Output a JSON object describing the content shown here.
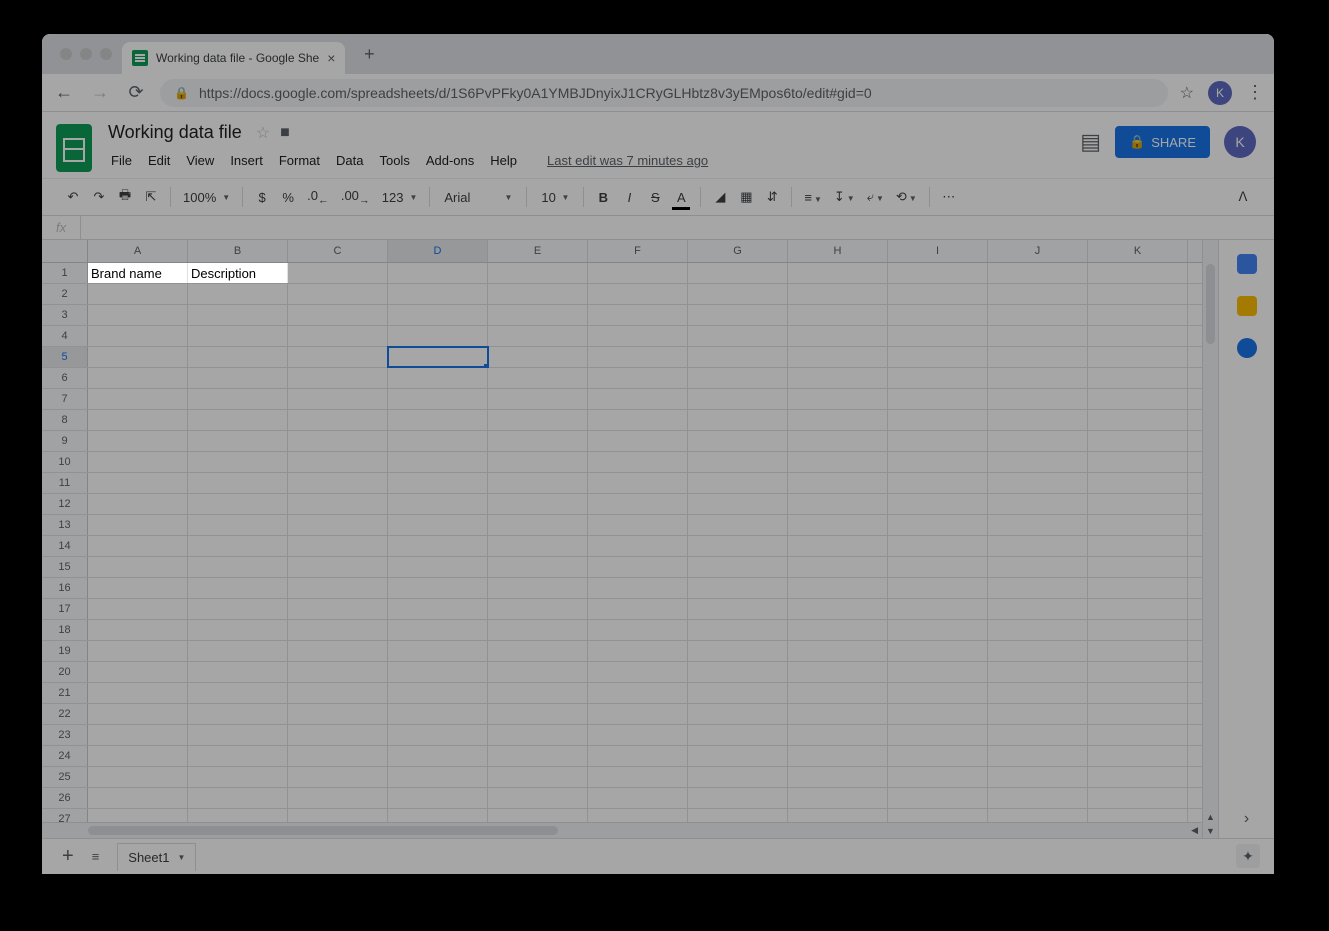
{
  "browser": {
    "tab_title": "Working data file - Google She",
    "url_display": "https://docs.google.com/spreadsheets/d/1S6PvPFky0A1YMBJDnyixJ1CRyGLHbtz8v3yEMpos6to/edit#gid=0",
    "avatar_letter": "K"
  },
  "doc": {
    "title": "Working data file",
    "last_edit": "Last edit was 7 minutes ago",
    "share_label": "SHARE",
    "avatar_letter": "K"
  },
  "menus": {
    "file": "File",
    "edit": "Edit",
    "view": "View",
    "insert": "Insert",
    "format": "Format",
    "data": "Data",
    "tools": "Tools",
    "addons": "Add-ons",
    "help": "Help"
  },
  "toolbar": {
    "zoom": "100%",
    "format_num": "123",
    "font": "Arial",
    "font_size": "10",
    "currency": "$",
    "percent": "%",
    "dec_less": ".0",
    "dec_more": ".00",
    "bold": "B",
    "italic": "I",
    "strike": "S",
    "textcolor": "A"
  },
  "formula": {
    "fx": "fx",
    "value": ""
  },
  "grid": {
    "columns": [
      "A",
      "B",
      "C",
      "D",
      "E",
      "F",
      "G",
      "H",
      "I",
      "J",
      "K"
    ],
    "row_count": 27,
    "selected_cell": "D5",
    "cells": {
      "A1": "Brand name",
      "B1": "Description"
    }
  },
  "sheets": {
    "add": "+",
    "all": "≡",
    "tab1": "Sheet1"
  }
}
